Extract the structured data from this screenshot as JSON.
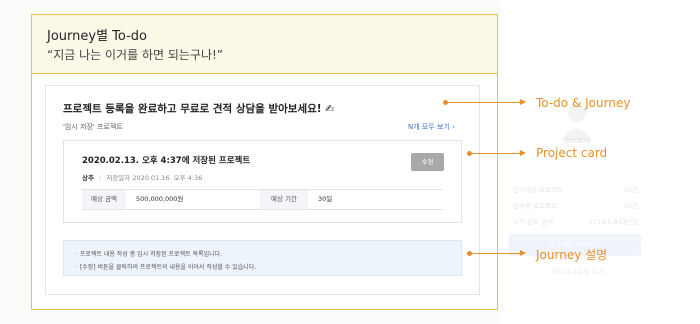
{
  "background_panel": {
    "name": "Sookie",
    "rows": [
      {
        "label": "임시저장 프로젝트",
        "value": "20건"
      },
      {
        "label": "검수중 프로젝트",
        "value": "20건"
      },
      {
        "label": "누적 완료 금액",
        "value": "2719,5,943만원"
      }
    ],
    "button_label": "프로젝트 등록하기",
    "link_label": "파트너 프로필 보기"
  },
  "header": {
    "title": "Journey별 To-do",
    "subtitle": "“지금 나는 이거를 하면 되는구나!”"
  },
  "todo": {
    "title": "프로젝트 등록을 완료하고 무료로 견적 상담을 받아보세요! ✍",
    "subtitle": "'임시 저장' 프로젝트",
    "view_all": "N개 모두 보기 ›"
  },
  "project_card": {
    "title": "2020.02.13. 오후 4:37에 저장된 프로젝트",
    "category": "상주",
    "saved_label": "저장일자",
    "saved_date": "2020.01.16. 오후 4:36",
    "edit_label": "수정",
    "budget_label": "예상 금액",
    "budget_value": "500,000,000원",
    "period_label": "예상 기간",
    "period_value": "30일"
  },
  "info_box": {
    "lines": [
      "· 프로젝트 내용 작성 중 임시 저장된 프로젝트 목록입니다.",
      "· [수정] 버튼을 클릭하여 프로젝트의 내용을 이어서 작성할 수 있습니다."
    ]
  },
  "callouts": {
    "todo_journey": "To-do & Journey",
    "project_card": "Project card",
    "journey_desc": "Journey 설명"
  },
  "colors": {
    "accent": "#e8912a",
    "frame": "#f0c040",
    "frame_header_bg": "#fdf9e9",
    "link": "#3c6fd8",
    "button_gray": "#a9a9a9",
    "info_bg": "#eef4fb"
  },
  "icons": {
    "writing_hand": "writing-hand-icon",
    "avatar": "avatar-icon"
  }
}
